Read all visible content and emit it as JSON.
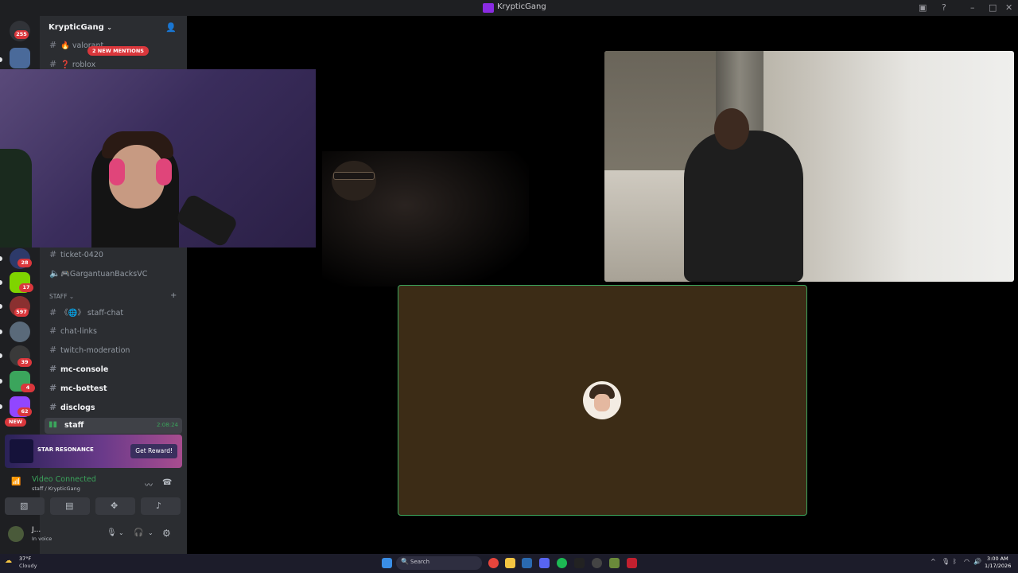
{
  "window": {
    "title": "KrypticGang"
  },
  "server_rail": {
    "badges": [
      "255",
      "28",
      "17",
      "597",
      "39",
      "4",
      "62"
    ],
    "new_label": "NEW"
  },
  "sidebar": {
    "server_name": "KrypticGang",
    "mentions_banner": "2 NEW MENTIONS",
    "channels_top": [
      {
        "name": "valorant",
        "emoji": "🔥"
      },
      {
        "name": "roblox",
        "emoji": "❓"
      }
    ],
    "channels_mid": [
      {
        "name": "ticket-0420",
        "type": "text"
      },
      {
        "name": "GargantuanBacksVC",
        "type": "voice",
        "emoji": "🎮"
      }
    ],
    "category": "STAFF",
    "channels_staff": [
      {
        "name": "staff-chat",
        "prefix": "《🌐》",
        "unread": false
      },
      {
        "name": "chat-links",
        "unread": false
      },
      {
        "name": "twitch-moderation",
        "unread": false
      },
      {
        "name": "mc-console",
        "unread": true
      },
      {
        "name": "mc-bottest",
        "unread": true
      },
      {
        "name": "disclogs",
        "unread": true
      }
    ],
    "active_voice": {
      "name": "staff",
      "timer": "2:08:24"
    }
  },
  "promo": {
    "game": "STAR RESONANCE",
    "button": "Get Reward!"
  },
  "voice_status": {
    "status": "Video Connected",
    "channel": "staff / KrypticGang"
  },
  "user": {
    "name": "J...",
    "status": "In voice"
  },
  "taskbar": {
    "weather_temp": "37°F",
    "weather_cond": "Cloudy",
    "search_placeholder": "Search",
    "time": "3:00 AM",
    "date": "1/17/2026"
  },
  "colors": {
    "accent_green": "#3ba55c",
    "badge_red": "#da373c",
    "sidebar_bg": "#2b2d31",
    "rail_bg": "#1e1f22",
    "avatar_tile_bg": "#3c2c16"
  }
}
